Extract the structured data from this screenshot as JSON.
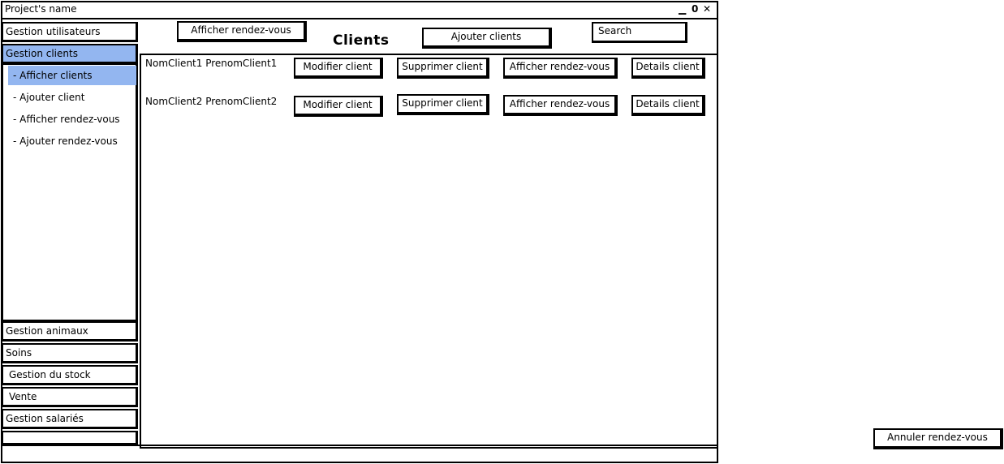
{
  "window": {
    "title": "Project's name",
    "minimize_label": "▁",
    "maximize_label": "0",
    "close_label": "✕"
  },
  "sidebar": {
    "gestion_utilisateurs": "Gestion utilisateurs",
    "gestion_clients": "Gestion clients",
    "sub_items": [
      "- Afficher clients",
      "- Ajouter client",
      "- Afficher rendez-vous",
      "- Ajouter rendez-vous"
    ],
    "bottom_items": [
      "Gestion animaux",
      "Soins",
      "Gestion du stock",
      "Vente",
      "Gestion salariés"
    ]
  },
  "header": {
    "afficher_rdv_label": "Afficher rendez-vous",
    "title": "Clients",
    "ajouter_clients_label": "Ajouter clients",
    "search_placeholder": "Search"
  },
  "clients": [
    {
      "name": "NomClient1 PrenomClient1",
      "modifier": "Modifier client",
      "supprimer": "Supprimer client",
      "afficher_rdv": "Afficher rendez-vous",
      "details": "Details client"
    },
    {
      "name": "NomClient2 PrenomClient2",
      "modifier": "Modifier client",
      "supprimer": "Supprimer client",
      "afficher_rdv": "Afficher rendez-vous",
      "details": "Details client"
    }
  ],
  "annuler_rdv_label": "Annuler rendez-vous"
}
